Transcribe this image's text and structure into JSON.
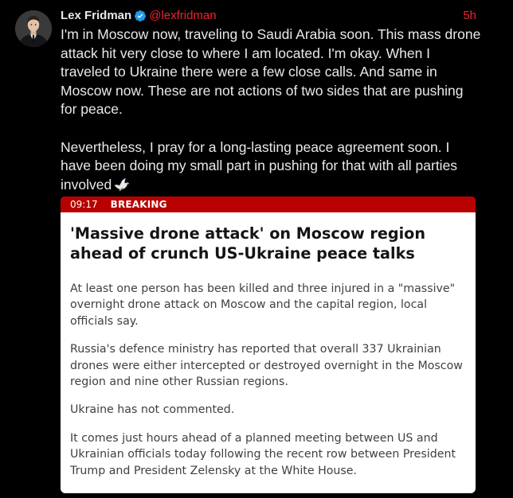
{
  "tweet": {
    "display_name": "Lex Fridman",
    "handle": "@lexfridman",
    "time": "5h",
    "avatar_icon": "profile-photo",
    "verified_icon": "verified-badge-icon",
    "paragraph_1": "I'm in Moscow now, traveling to Saudi Arabia soon. This mass drone attack hit very close to where I am located. I'm okay. When I traveled to Ukraine there were a few close calls. And same in Moscow now. These are not actions of two sides that are pushing for peace.",
    "paragraph_2": "Nevertheless, I pray for a long-lasting peace agreement soon. I have been doing my small part in pushing for that with all parties involved",
    "emoji": "dove-emoji"
  },
  "card": {
    "time": "09:17",
    "label": "BREAKING",
    "headline": "'Massive drone attack' on Moscow region ahead of crunch US-Ukraine peace talks",
    "paragraphs": [
      "At least one person has been killed and three injured in a \"massive\" overnight drone attack on Moscow and the capital region, local officials say.",
      "Russia's defence ministry has reported that overall 337 Ukrainian drones were either intercepted or destroyed overnight in the Moscow region and nine other Russian regions.",
      "Ukraine has not commented.",
      "It comes just hours ahead of a planned meeting between US and Ukrainian officials today following the recent row between President Trump and President Zelensky at the White House."
    ]
  },
  "colors": {
    "background": "#000000",
    "text": "#e7e9ea",
    "handle_and_time": "#f4212e",
    "breaking_bar": "#b80000",
    "verified": "#1d9bf0"
  }
}
